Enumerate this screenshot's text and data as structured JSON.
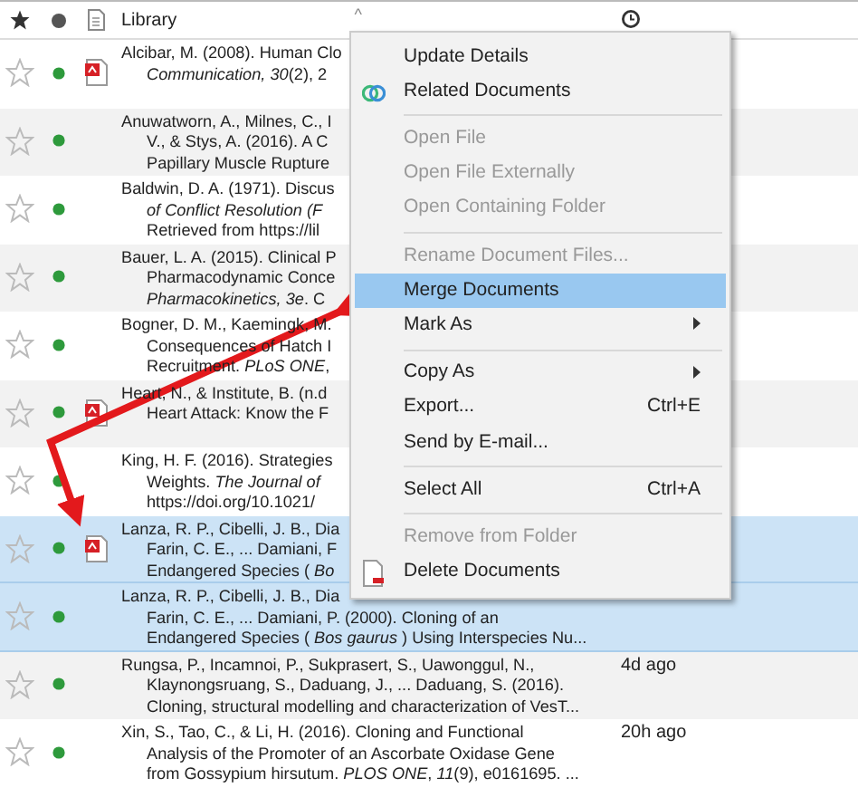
{
  "header": {
    "library": "Library",
    "sort_indicator": "^"
  },
  "rows": [
    {
      "starred": false,
      "unread": true,
      "pdf": true,
      "selected": false,
      "lines": [
        "Alcibar, M. (2008). Human Clo",
        "*Communication, 30*(2), 2"
      ]
    },
    {
      "starred": false,
      "unread": true,
      "pdf": false,
      "selected": false,
      "lines": [
        "Anuwatworn, A., Milnes, C., I",
        "V., & Stys, A. (2016). A C",
        "Papillary Muscle Rupture"
      ]
    },
    {
      "starred": false,
      "unread": true,
      "pdf": false,
      "selected": false,
      "lines": [
        "Baldwin, D. A. (1971). Discus",
        "*of Conflict Resolution  (F*",
        "Retrieved from https://lil"
      ]
    },
    {
      "starred": false,
      "unread": true,
      "pdf": false,
      "selected": false,
      "lines": [
        "Bauer, L. A. (2015). Clinical P",
        "Pharmacodynamic Conce",
        "*Pharmacokinetics, 3e*. C"
      ]
    },
    {
      "starred": false,
      "unread": true,
      "pdf": false,
      "selected": false,
      "lines": [
        "Bogner, D. M., Kaemingk, M.",
        "Consequences of Hatch I",
        "Recruitment. *PLoS ONE*,"
      ]
    },
    {
      "starred": false,
      "unread": true,
      "pdf": true,
      "selected": false,
      "lines": [
        "Heart, N., & Institute, B. (n.d",
        "Heart Attack: Know the F"
      ]
    },
    {
      "starred": false,
      "unread": true,
      "pdf": false,
      "selected": false,
      "lines": [
        "King, H. F. (2016). Strategies",
        "Weights. *The Journal of*",
        "https://doi.org/10.1021/"
      ]
    },
    {
      "starred": false,
      "unread": true,
      "pdf": true,
      "selected": true,
      "lines": [
        "Lanza, R. P., Cibelli, J. B., Dia",
        "Farin, C. E., ... Damiani, F",
        "Endangered Species ( *Bo*"
      ]
    },
    {
      "starred": false,
      "unread": true,
      "pdf": false,
      "selected": true,
      "lines": [
        "Lanza, R. P., Cibelli, J. B., Dia",
        "Farin, C. E., ... Damiani, P. (2000). Cloning of an",
        "Endangered Species ( *Bos gaurus* ) Using Interspecies Nu..."
      ]
    },
    {
      "starred": false,
      "unread": true,
      "pdf": false,
      "selected": false,
      "lines": [
        "Rungsa, P., Incamnoi, P., Sukprasert, S., Uawonggul, N.,",
        "Klaynongsruang, S., Daduang, J., ... Daduang, S. (2016).",
        "Cloning, structural modelling and characterization of VesT..."
      ],
      "time": "4d ago"
    },
    {
      "starred": false,
      "unread": true,
      "pdf": false,
      "selected": false,
      "lines": [
        "Xin, S., Tao, C., & Li, H. (2016). Cloning and Functional",
        "Analysis of the Promoter of an Ascorbate Oxidase Gene",
        "from Gossypium hirsutum. *PLOS ONE*, *11*(9), e0161695. ..."
      ],
      "time": "20h ago"
    }
  ],
  "context_menu": [
    {
      "kind": "item",
      "label": "Update Details",
      "disabled": false,
      "selected": false
    },
    {
      "kind": "related",
      "label": "Related Documents",
      "disabled": false,
      "selected": false
    },
    {
      "kind": "separator"
    },
    {
      "kind": "item",
      "label": "Open File",
      "disabled": true,
      "selected": false
    },
    {
      "kind": "item",
      "label": "Open File Externally",
      "disabled": true,
      "selected": false
    },
    {
      "kind": "item",
      "label": "Open Containing Folder",
      "disabled": true,
      "selected": false
    },
    {
      "kind": "separator"
    },
    {
      "kind": "item",
      "label": "Rename Document Files...",
      "disabled": true,
      "selected": false
    },
    {
      "kind": "item",
      "label": "Merge Documents",
      "disabled": false,
      "selected": true
    },
    {
      "kind": "item",
      "label": "Mark As",
      "disabled": false,
      "selected": false,
      "submenu": true
    },
    {
      "kind": "separator"
    },
    {
      "kind": "item",
      "label": "Copy As",
      "disabled": false,
      "selected": false,
      "submenu": true
    },
    {
      "kind": "item",
      "label": "Export...",
      "disabled": false,
      "selected": false,
      "shortcut": "Ctrl+E"
    },
    {
      "kind": "item",
      "label": "Send by E-mail...",
      "disabled": false,
      "selected": false
    },
    {
      "kind": "separator"
    },
    {
      "kind": "item",
      "label": "Select All",
      "disabled": false,
      "selected": false,
      "shortcut": "Ctrl+A"
    },
    {
      "kind": "separator"
    },
    {
      "kind": "item",
      "label": "Remove from Folder",
      "disabled": true,
      "selected": false
    },
    {
      "kind": "delete",
      "label": "Delete Documents",
      "disabled": false,
      "selected": false
    }
  ]
}
